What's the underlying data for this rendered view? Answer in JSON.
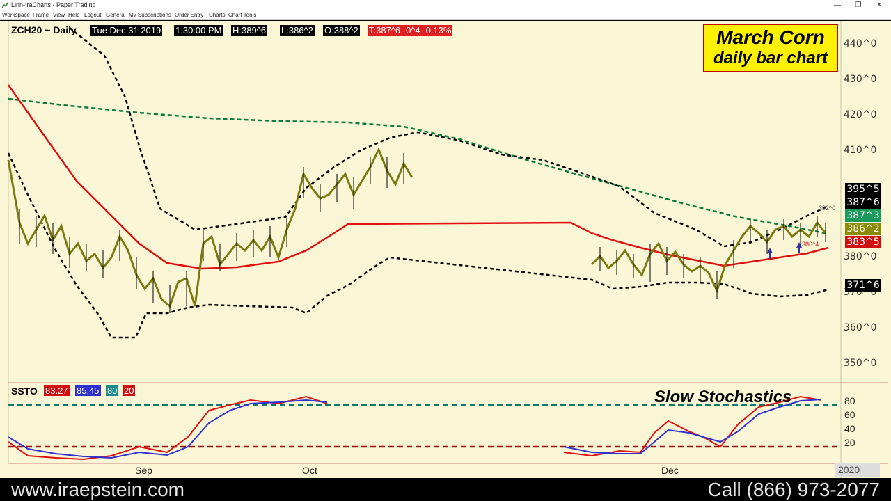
{
  "window": {
    "title": "Linn-IraCharts - Paper Trading",
    "controls": {
      "minimize": "—",
      "maximize": "❐",
      "close": "✕"
    }
  },
  "menu": {
    "items": [
      "Workspace",
      "Frame",
      "View",
      "Help",
      "Logout",
      "General",
      "My Subscriptions",
      "Order Entry",
      "Charts",
      "Chart Tools"
    ]
  },
  "chart_info": {
    "symbol": "ZCH20 ~ Daily",
    "datetime": "Tue Dec 31 2019",
    "time": "1:30:00 PM",
    "high": "H:389^6",
    "low": "L:386^2",
    "open": "O:388^2",
    "last": "T:387^6  -0^4  -0.13%"
  },
  "callout": {
    "line1": "March Corn",
    "line2": "daily bar chart"
  },
  "price_axis": [
    "440^0",
    "430^0",
    "420^0",
    "410^0",
    "380^0",
    "370^0",
    "360^0",
    "350^0"
  ],
  "price_tags": [
    {
      "text": "395^5",
      "bg": "#000000",
      "fg": "#ffffff"
    },
    {
      "text": "387^6",
      "bg": "#000000",
      "fg": "#ffffff"
    },
    {
      "text": "387^3",
      "bg": "#1a9a5a",
      "fg": "#ffffff"
    },
    {
      "text": "386^2",
      "bg": "#8a8a00",
      "fg": "#ffffff"
    },
    {
      "text": "383^5",
      "bg": "#d01010",
      "fg": "#ffffff"
    },
    {
      "text": "371^6",
      "bg": "#000000",
      "fg": "#ffffff"
    }
  ],
  "annotations": {
    "upper": "392^0",
    "lower": "386^4"
  },
  "ssto": {
    "label": "SSTO",
    "k": "83.27",
    "d": "85.45",
    "upper": "80",
    "lower": "20",
    "title": "Slow Stochastics",
    "axis": [
      "80",
      "60",
      "40",
      "20"
    ]
  },
  "months": [
    "Sep",
    "Oct",
    "Dec"
  ],
  "year": "2020",
  "footer": {
    "url": "www.iraepstein.com",
    "phone": "Call (866) 973-2077"
  },
  "colors": {
    "background": "#fbf7d6",
    "price_line": "#7a7a10",
    "moving_avg": "#e01010",
    "long_ma": "#0a7a3a",
    "bands": "#000000",
    "stoch_k": "#e01010",
    "stoch_d": "#3030d0",
    "callout_bg": "#fff200"
  },
  "chart_data": {
    "type": "line",
    "series": [],
    "ylim": [
      345,
      445
    ]
  }
}
